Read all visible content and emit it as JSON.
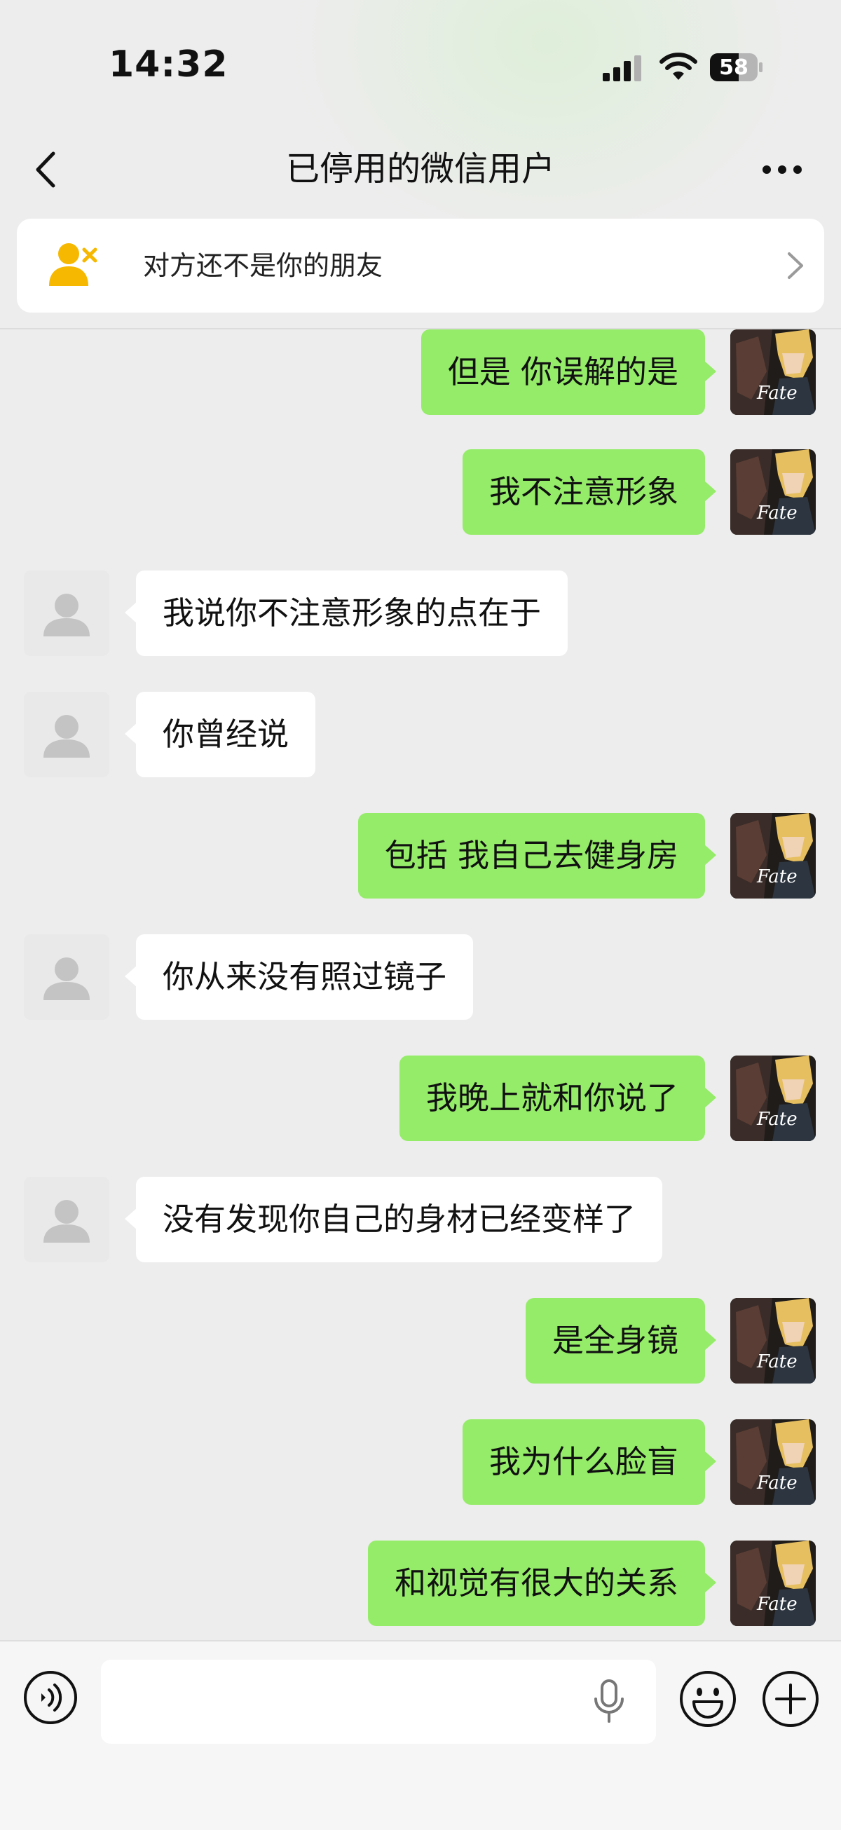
{
  "status_bar": {
    "time": "14:32",
    "battery": "58"
  },
  "nav": {
    "title": "已停用的微信用户"
  },
  "banner": {
    "text": "对方还不是你的朋友"
  },
  "messages": [
    {
      "side": "me",
      "text": "但是 你误解的是"
    },
    {
      "side": "me",
      "text": "我不注意形象"
    },
    {
      "side": "other",
      "text": "我说你不注意形象的点在于"
    },
    {
      "side": "other",
      "text": "你曾经说"
    },
    {
      "side": "me",
      "text": "包括 我自己去健身房"
    },
    {
      "side": "other",
      "text": "你从来没有照过镜子"
    },
    {
      "side": "me",
      "text": "我晚上就和你说了"
    },
    {
      "side": "other",
      "text": "没有发现你自己的身材已经变样了"
    },
    {
      "side": "me",
      "text": "是全身镜"
    },
    {
      "side": "me",
      "text": "我为什么脸盲"
    },
    {
      "side": "me",
      "text": "和视觉有很大的关系"
    }
  ],
  "my_avatar": {
    "caption": "Fate"
  },
  "colors": {
    "my_bubble": "#95ec69",
    "other_bubble": "#ffffff",
    "banner_icon": "#f6b800",
    "background": "#ededed"
  },
  "icons": {
    "back": "chevron-left-icon",
    "more": "more-dots-icon",
    "banner": "user-remove-icon",
    "banner_chevron": "chevron-right-icon",
    "voice": "voice-icon",
    "mic": "microphone-icon",
    "emoji": "emoji-icon",
    "plus": "plus-circle-icon"
  }
}
